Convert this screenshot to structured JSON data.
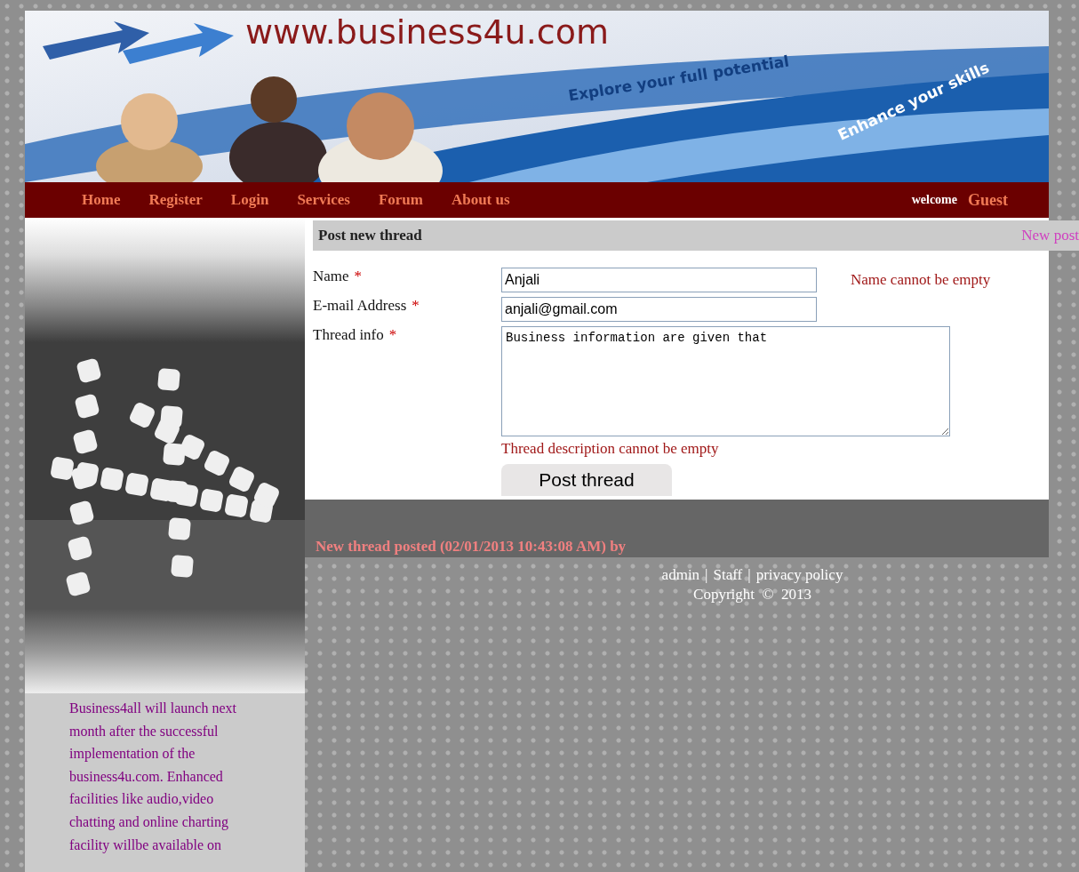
{
  "banner": {
    "logo": "www.business4u.com",
    "taglines": [
      "Explore your full potential",
      "Enhance your skills"
    ]
  },
  "nav": {
    "items": [
      "Home",
      "Register",
      "Login",
      "Services",
      "Forum",
      "About us"
    ],
    "welcome": "welcome",
    "user": "Guest"
  },
  "sidebar": {
    "text": "Business4all will launch next month after the successful implementation of the business4u.com. Enhanced facilities like audio,video chatting and online charting facility willbe available on"
  },
  "form": {
    "title": "Post new thread",
    "new_post_link": "New post",
    "fields": [
      {
        "label": "Name",
        "required_mark": "*",
        "kind": "input",
        "value": "Anjali",
        "error": "Name cannot be empty"
      },
      {
        "label": "E-mail Address",
        "required_mark": "*",
        "kind": "input",
        "value": "anjali@gmail.com"
      },
      {
        "label": "Thread info",
        "required_mark": "*",
        "kind": "textarea",
        "value": "Business information are given that",
        "error": "Thread description cannot be empty"
      }
    ],
    "submit": "Post thread"
  },
  "recent": "New thread posted (02/01/2013 10:43:08 AM) by",
  "footer": {
    "links": [
      {
        "text": "admin",
        "separator": "|"
      },
      {
        "text": "Staff",
        "separator": "|"
      },
      {
        "text": "privacy policy"
      }
    ],
    "copyright": "Copyright  ©  2013"
  }
}
